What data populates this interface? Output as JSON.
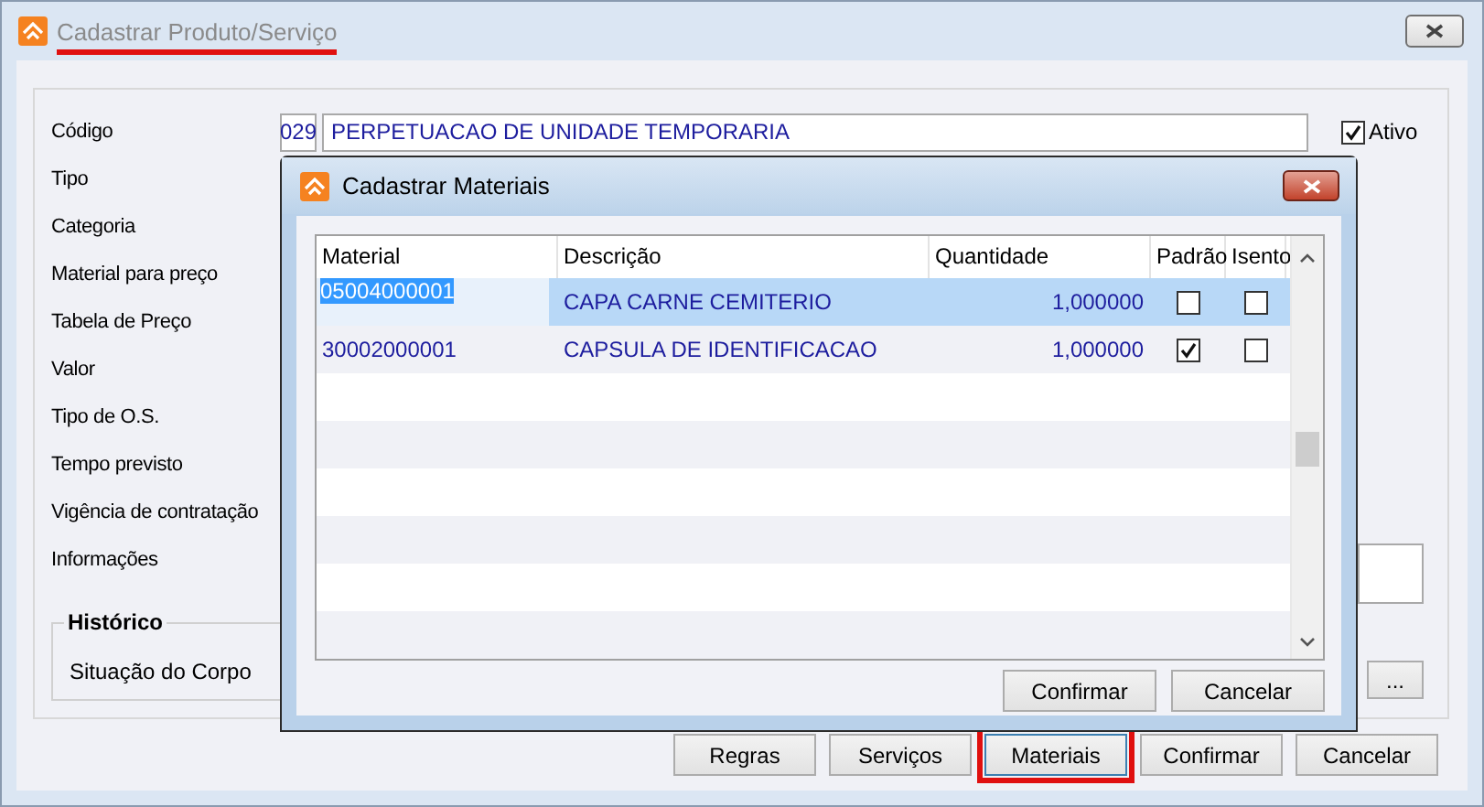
{
  "window": {
    "title": "Cadastrar Produto/Serviço",
    "title_highlighted": true
  },
  "form": {
    "fields": [
      {
        "label": "Código",
        "kind": "code",
        "code": "029",
        "value": "PERPETUACAO DE UNIDADE TEMPORARIA"
      },
      {
        "label": "Tipo",
        "kind": "hidden"
      },
      {
        "label": "Categoria",
        "kind": "hidden"
      },
      {
        "label": "Material para preço",
        "kind": "hidden"
      },
      {
        "label": "Tabela de Preço",
        "kind": "hidden"
      },
      {
        "label": "Valor",
        "kind": "hidden"
      },
      {
        "label": "Tipo de O.S.",
        "kind": "hidden"
      },
      {
        "label": "Tempo previsto",
        "kind": "hidden"
      },
      {
        "label": "Vigência de contratação",
        "kind": "hidden"
      },
      {
        "label": "Informações",
        "kind": "memo"
      }
    ],
    "ativo": {
      "label": "Ativo",
      "checked": true
    },
    "group": {
      "title": "Histórico",
      "label": "Situação do Corpo",
      "button": "..."
    }
  },
  "buttons": [
    {
      "label": "Regras",
      "highlighted": false
    },
    {
      "label": "Serviços",
      "highlighted": false
    },
    {
      "label": "Materiais",
      "highlighted": true
    },
    {
      "label": "Confirmar",
      "highlighted": false
    },
    {
      "label": "Cancelar",
      "highlighted": false
    }
  ],
  "dialog": {
    "title": "Cadastrar Materiais",
    "columns": [
      "Material",
      "Descrição",
      "Quantidade",
      "Padrão",
      "Isento"
    ],
    "rows": [
      {
        "material": "05004000001",
        "descricao": "CAPA CARNE CEMITERIO",
        "quantidade": "1,000000",
        "padrao": false,
        "isento": false,
        "selected": true
      },
      {
        "material": "30002000001",
        "descricao": "CAPSULA DE IDENTIFICACAO",
        "quantidade": "1,000000",
        "padrao": true,
        "isento": false,
        "selected": false
      }
    ],
    "buttons": [
      "Confirmar",
      "Cancelar"
    ]
  }
}
